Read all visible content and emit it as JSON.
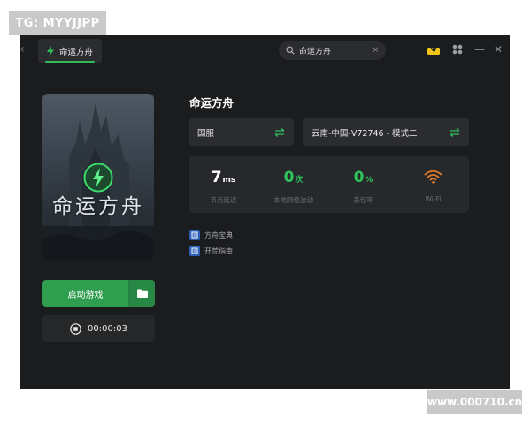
{
  "watermarks": {
    "top_left": "TG: MYYJJPP",
    "bottom_right": "www.000710.cn"
  },
  "header": {
    "tab_label": "命运方舟",
    "search_value": "命运方舟",
    "search_clear": "×"
  },
  "game": {
    "title": "命运方舟",
    "cover_title": "命运方舟",
    "launch_label": "启动游戏",
    "timer": "00:00:03"
  },
  "selectors": {
    "region": "国服",
    "server": "云南-中国-V72746 - 模式二"
  },
  "stats": [
    {
      "value": "7",
      "unit": "ms",
      "label": "节点延迟",
      "color": "#ffffff"
    },
    {
      "value": "0",
      "unit": "次",
      "label": "本地网络波动",
      "color": "#2fc25b"
    },
    {
      "value": "0",
      "unit": "%",
      "label": "丢包率",
      "color": "#2fc25b"
    },
    {
      "value": "",
      "unit": "",
      "label": "Wi-Fi",
      "color": "#e07b2a",
      "icon": "wifi-icon"
    }
  ],
  "links": [
    {
      "label": "方舟宝典"
    },
    {
      "label": "开荒指南"
    }
  ],
  "colors": {
    "accent": "#2fbf5a",
    "background": "#1b1c1e",
    "panel": "#2a2c2f",
    "wifi": "#e07b2a"
  }
}
